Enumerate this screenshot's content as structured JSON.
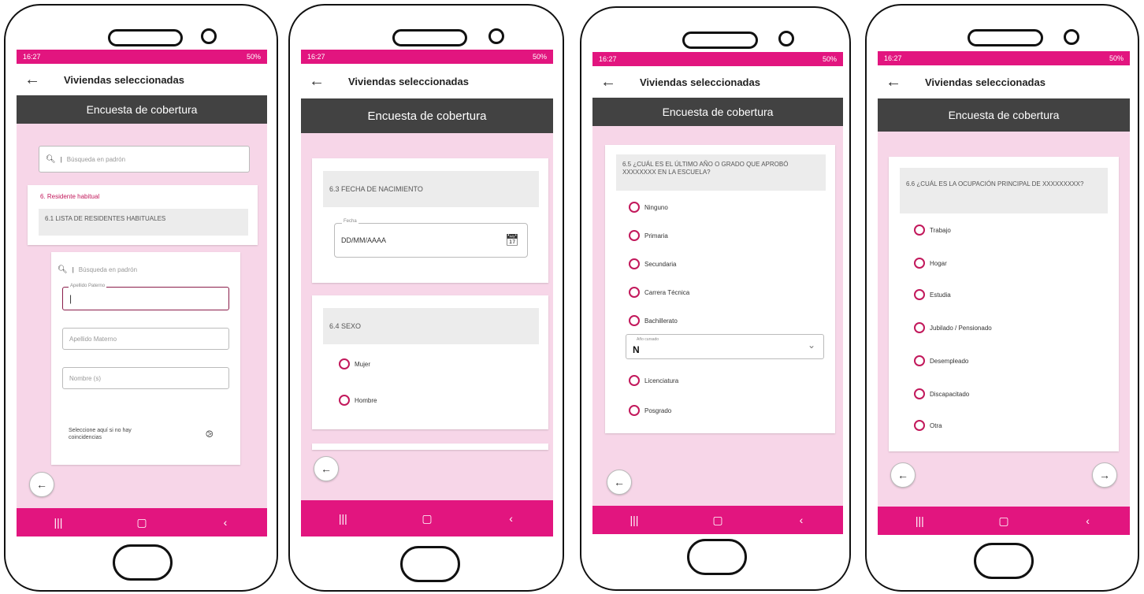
{
  "status": {
    "time": "16:27",
    "battery": "50%"
  },
  "appbar": {
    "back_icon": "arrow-left-icon",
    "title": "Viviendas seleccionadas"
  },
  "subheader": "Encuesta de cobertura",
  "nav": {
    "recents": "|||",
    "home": "▢",
    "back": "‹"
  },
  "screen1": {
    "search_placeholder": "Búsqueda en padrón",
    "section_title": "6. Residente habitual",
    "subsection": "6.1 LISTA DE RESIDENTES HABITUALES",
    "inner_search_placeholder": "Búsqueda en padrón",
    "field_paterno_label": "Apellido Paterno",
    "field_materno_placeholder": "Apellido Materno",
    "field_nombre_placeholder": "Nombre (s)",
    "no_match_text": "Seleccione aquí si no hay coincidencias"
  },
  "screen2": {
    "q_birth": "6.3 FECHA DE NACIMIENTO",
    "date_label": "Fecha",
    "date_placeholder": "DD/MM/AAAA",
    "q_sex": "6.4 SEXO",
    "options": [
      "Mujer",
      "Hombre"
    ]
  },
  "screen3": {
    "question": "6.5 ¿CUÁL ES EL ÚLTIMO AÑO O GRADO QUE APROBÓ XXXXXXXX EN LA ESCUELA?",
    "options_top": [
      "Ninguno",
      "Primaria",
      "Secundaria",
      "Carrera Técnica",
      "Bachillerato"
    ],
    "select_label": "Año cursado",
    "select_value": "N",
    "options_bottom": [
      "Licenciatura",
      "Posgrado"
    ]
  },
  "screen4": {
    "question": "6.6 ¿CUÁL ES LA OCUPACIÓN PRINCIPAL DE XXXXXXXXX?",
    "options": [
      "Trabajo",
      "Hogar",
      "Estudia",
      "Jubilado / Pensionado",
      "Desempleado",
      "Discapacitado",
      "Otra"
    ]
  },
  "colors": {
    "accent": "#e2157f",
    "background": "#f7d6e8",
    "header": "#424242",
    "radio": "#c2185b"
  }
}
